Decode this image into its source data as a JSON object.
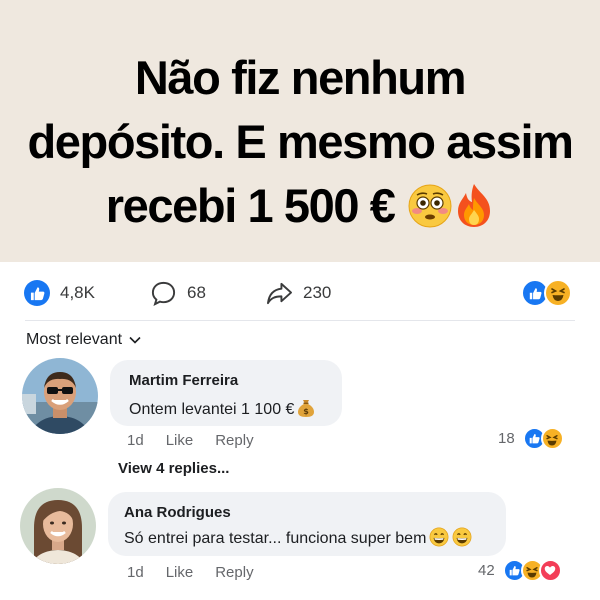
{
  "post": {
    "headline_lines": [
      "Não fiz nenhum",
      "depósito. E mesmo assim",
      "recebi 1 500 €"
    ],
    "headline_emojis": [
      "flushed-face-emoji",
      "fire-emoji"
    ],
    "banner_color": "#efe8df"
  },
  "stats": {
    "reactions": "4,8K",
    "comments": "68",
    "shares": "230",
    "reaction_types": [
      "like",
      "haha"
    ]
  },
  "sort": {
    "label": "Most relevant"
  },
  "comments": [
    {
      "author": "Martim Ferreira",
      "text": "Ontem levantei 1 100 €",
      "emojis": [
        "money-bag-emoji"
      ],
      "time": "1d",
      "like_label": "Like",
      "reply_label": "Reply",
      "reaction_count": "18",
      "reaction_types": [
        "like",
        "haha"
      ],
      "view_replies": "View 4 replies..."
    },
    {
      "author": "Ana Rodrigues",
      "text": "Só entrei para testar... funciona super bem",
      "emojis": [
        "grinning-face-emoji",
        "grinning-face-emoji"
      ],
      "time": "1d",
      "like_label": "Like",
      "reply_label": "Reply",
      "reaction_count": "42",
      "reaction_types": [
        "like",
        "haha",
        "love"
      ]
    }
  ],
  "colors": {
    "like": "#1877f2",
    "haha": "#f7b125",
    "love": "#f33e58",
    "secondary_text": "#65676b",
    "bubble": "#f0f2f5"
  }
}
